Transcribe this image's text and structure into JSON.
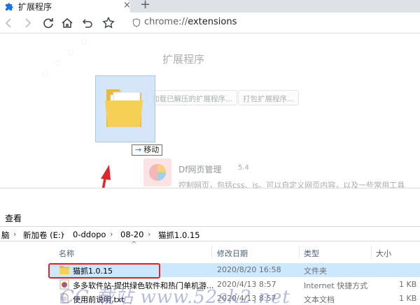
{
  "browser": {
    "tab_title": "扩展程序",
    "tab_close": "×",
    "new_tab": "+",
    "address_scheme": "chrome://",
    "address_path": "extensions"
  },
  "extensions_page": {
    "title": "扩展程序",
    "load_unpacked_button": "加载已解压的扩展程序...",
    "pack_button": "打包扩展程序...",
    "extension": {
      "name": "Df网页管理",
      "version": "5.4",
      "description": "控制网页，包括css、js。可以自定义网页内容，以及一些常用工具"
    }
  },
  "drag": {
    "tooltip_arrow": "→",
    "tooltip_label": "移动"
  },
  "explorer": {
    "ribbon_label": "查看",
    "breadcrumb": [
      "脑",
      "新加卷 (E:)",
      "0-ddopo",
      "08-20",
      "猫抓1.0.15"
    ],
    "columns": {
      "name": "名称",
      "modified": "修改日期",
      "type": "类型",
      "size": "大小"
    },
    "files": [
      {
        "name": "猫抓1.0.15",
        "modified": "2020/8/20 16:58",
        "type": "文件夹",
        "size": "",
        "icon": "folder-icon",
        "selected": true
      },
      {
        "name": "多多软件站-提供绿色软件和热门单机游...",
        "modified": "2020/4/13 8:57",
        "type": "Internet 快捷方式",
        "size": "1 KB",
        "icon": "internet-shortcut-icon",
        "selected": false
      },
      {
        "name": "使用前说明.txt",
        "modified": "2020/4/13 8:57",
        "type": "文本文档",
        "size": "1 KB",
        "icon": "text-file-icon",
        "selected": false
      }
    ]
  },
  "watermark": {
    "footer": "CC 载站 www.52sk2.net"
  },
  "colors": {
    "accent": "#1a73e8",
    "selection": "#cce8ff",
    "annotation_red": "#e0262b",
    "folder": "#f6c84a"
  }
}
